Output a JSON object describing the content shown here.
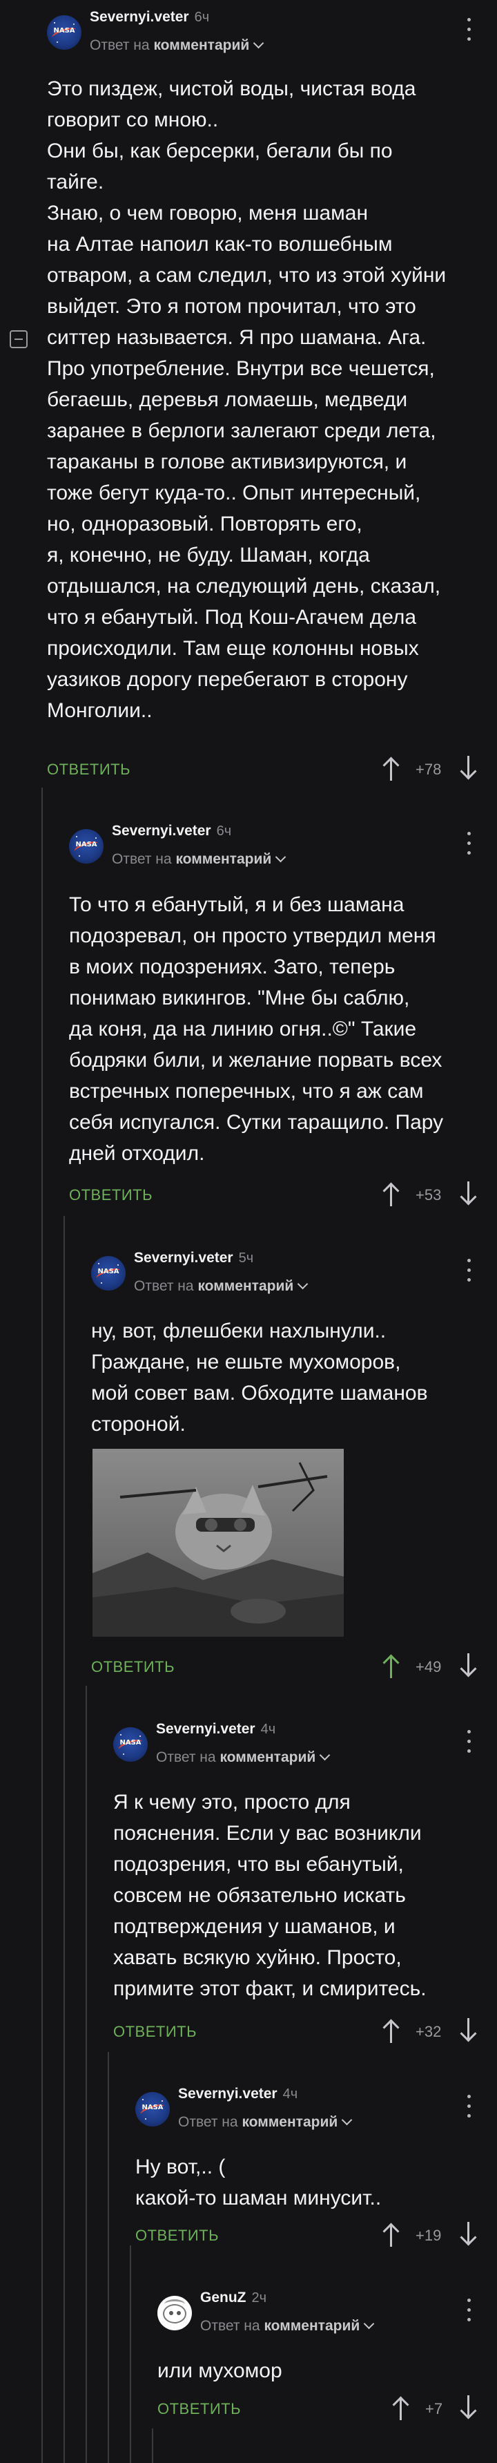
{
  "labels": {
    "reply_prefix": "Ответ на",
    "reply_target": "комментарий",
    "reply_button": "ОТВЕТИТЬ"
  },
  "comments": [
    {
      "username": "Severnyi.veter",
      "time": "6ч",
      "text": "Это пиздеж, чистой воды, чистая вода\nговорит со мною..\nОни бы, как берсерки, бегали бы по\nтайге.\nЗнаю, о чем говорю, меня шаман\nна Алтае напоил как-то волшебным\nотваром, а сам следил, что из этой хуйни\nвыйдет. Это я потом прочитал, что это\nситтер называется. Я про шамана. Ага.\nПро употребление. Внутри все чешется,\nбегаешь, деревья ломаешь, медведи\nзаранее в берлоги залегают среди лета,\nтараканы в голове активизируются, и\nтоже бегут куда-то.. Опыт интересный,\nно, одноразовый. Повторять его,\nя, конечно, не буду. Шаман, когда\nотдышался, на следующий день, сказал,\nчто я ебанутый. Под Кош-Агачем дела\nпроисходили. Там еще колонны новых\nуазиков дорогу перебегают в сторону\nМонголии..",
      "rating": "+78"
    },
    {
      "username": "Severnyi.veter",
      "time": "6ч",
      "text": "То что я ебанутый, я и без шамана\nподозревал, он просто утвердил меня\nв моих подозрениях. Зато, теперь\nпонимаю викингов. \"Мне бы саблю,\nда коня, да на линию огня..©\" Такие\nбодряки били, и желание порвать всех\nвстречных поперечных, что я аж сам\nсебя испугался. Сутки таращило. Пару\nдней отходил.",
      "rating": "+53"
    },
    {
      "username": "Severnyi.veter",
      "time": "5ч",
      "text": "ну, вот, флешбеки нахлынули..\nГраждане, не ешьте мухоморов,\nмой совет вам. Обходите шаманов\nстороной.",
      "rating": "+49"
    },
    {
      "username": "Severnyi.veter",
      "time": "4ч",
      "text": "Я к чему это, просто для\nпояснения. Если у вас возникли\nподозрения, что вы ебанутый,\nсовсем не обязательно искать\nподтверждения у шаманов, и\nхавать всякую хуйню. Просто,\nпримите этот факт, и смиритесь.",
      "rating": "+32"
    },
    {
      "username": "Severnyi.veter",
      "time": "4ч",
      "text": "Ну вот,.. (\nкакой-то шаман минусит..",
      "rating": "+19"
    },
    {
      "username": "GenuZ",
      "time": "2ч",
      "text": "или мухомор",
      "rating": "+7"
    }
  ],
  "colors": {
    "background": "#141416",
    "reply_green": "#6fb05a",
    "muted": "#8a8a8e"
  },
  "icons": [
    "avatar-nasa",
    "avatar-genuz",
    "more-vertical-icon",
    "chevron-down-icon",
    "arrow-up-icon",
    "arrow-down-icon",
    "collapse-icon"
  ]
}
